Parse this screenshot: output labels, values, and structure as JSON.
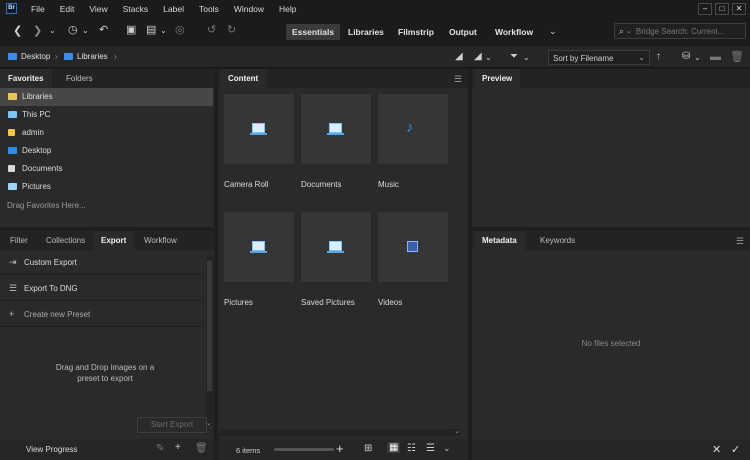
{
  "app": {
    "logo_text": "Br"
  },
  "menu": [
    "File",
    "Edit",
    "View",
    "Stacks",
    "Label",
    "Tools",
    "Window",
    "Help"
  ],
  "workspaces": {
    "tabs": [
      "Essentials",
      "Libraries",
      "Filmstrip",
      "Output",
      "Workflow"
    ],
    "active": "Essentials"
  },
  "search": {
    "placeholder": "Bridge Search: Current..."
  },
  "path": {
    "items": [
      "Desktop",
      "Libraries"
    ]
  },
  "sort": {
    "label": "Sort by Filename"
  },
  "favorites_panel": {
    "tabs": [
      "Favorites",
      "Folders"
    ],
    "items": [
      {
        "label": "Libraries",
        "icon": "libraries-icon",
        "selected": true
      },
      {
        "label": "This PC",
        "icon": "computer-icon"
      },
      {
        "label": "admin",
        "icon": "user-folder-icon"
      },
      {
        "label": "Desktop",
        "icon": "desktop-folder-icon"
      },
      {
        "label": "Documents",
        "icon": "documents-icon"
      },
      {
        "label": "Pictures",
        "icon": "pictures-icon"
      }
    ],
    "drag_hint": "Drag Favorites Here..."
  },
  "export_panel": {
    "tabs": [
      "Filter",
      "Collections",
      "Export",
      "Workflow"
    ],
    "active": "Export",
    "items": [
      {
        "label": "Custom Export",
        "icon": "export-icon"
      },
      {
        "label": "Export To DNG",
        "icon": "list-icon"
      },
      {
        "label": "Create new Preset",
        "icon": "plus-icon"
      }
    ],
    "drop_hint": "Drag and Drop images on a preset to export",
    "start_button": "Start Export",
    "footer_label": "View Progress"
  },
  "content_panel": {
    "tab": "Content",
    "items": [
      {
        "label": "Camera Roll",
        "icon": "camera-roll-icon"
      },
      {
        "label": "Documents",
        "icon": "documents-library-icon"
      },
      {
        "label": "Music",
        "icon": "music-icon"
      },
      {
        "label": "Pictures",
        "icon": "pictures-library-icon"
      },
      {
        "label": "Saved Pictures",
        "icon": "saved-pictures-icon"
      },
      {
        "label": "Videos",
        "icon": "videos-icon"
      }
    ],
    "item_count": "6 items"
  },
  "preview_panel": {
    "tab": "Preview"
  },
  "metadata_panel": {
    "tabs": [
      "Metadata",
      "Keywords"
    ],
    "active": "Metadata",
    "empty_text": "No files selected"
  },
  "colors": {
    "accent": "#3a8ee6",
    "background": "#1e1e1e",
    "panel": "#2a2a2a",
    "selected_row": "#474747"
  }
}
